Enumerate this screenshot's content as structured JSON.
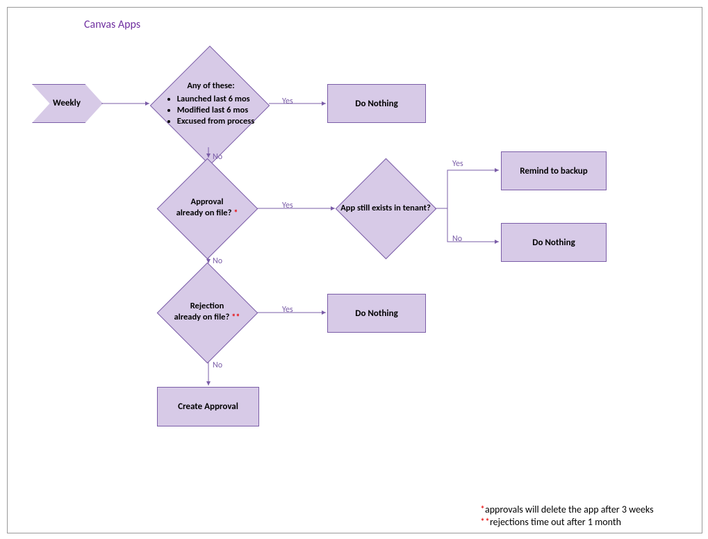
{
  "title": "Canvas Apps",
  "start": {
    "label": "Weekly"
  },
  "decisions": {
    "d1": {
      "header": "Any of these:",
      "items": [
        "Launched last 6 mos",
        "Modified last 6 mos",
        "Excused from process"
      ],
      "yes": "Yes",
      "no": "No"
    },
    "d2": {
      "text": "Approval",
      "text2": "already on file? ",
      "mark": "*",
      "yes": "Yes",
      "no": "No"
    },
    "d3": {
      "text": "Rejection",
      "text2": "already on file? ",
      "mark": "**",
      "yes": "Yes",
      "no": "No"
    },
    "d4": {
      "text": "App still exists in tenant?",
      "yes": "Yes",
      "no": "No"
    }
  },
  "processes": {
    "p_do_nothing": "Do Nothing",
    "p_remind": "Remind to backup",
    "p_do_nothing2": "Do Nothing",
    "p_do_nothing3": "Do Nothing",
    "p_create": "Create Approval"
  },
  "footnotes": {
    "f1_mark": "*",
    "f1_text": "approvals will delete the app after 3 weeks",
    "f2_mark": "**",
    "f2_text": "rejections time out after 1 month"
  }
}
